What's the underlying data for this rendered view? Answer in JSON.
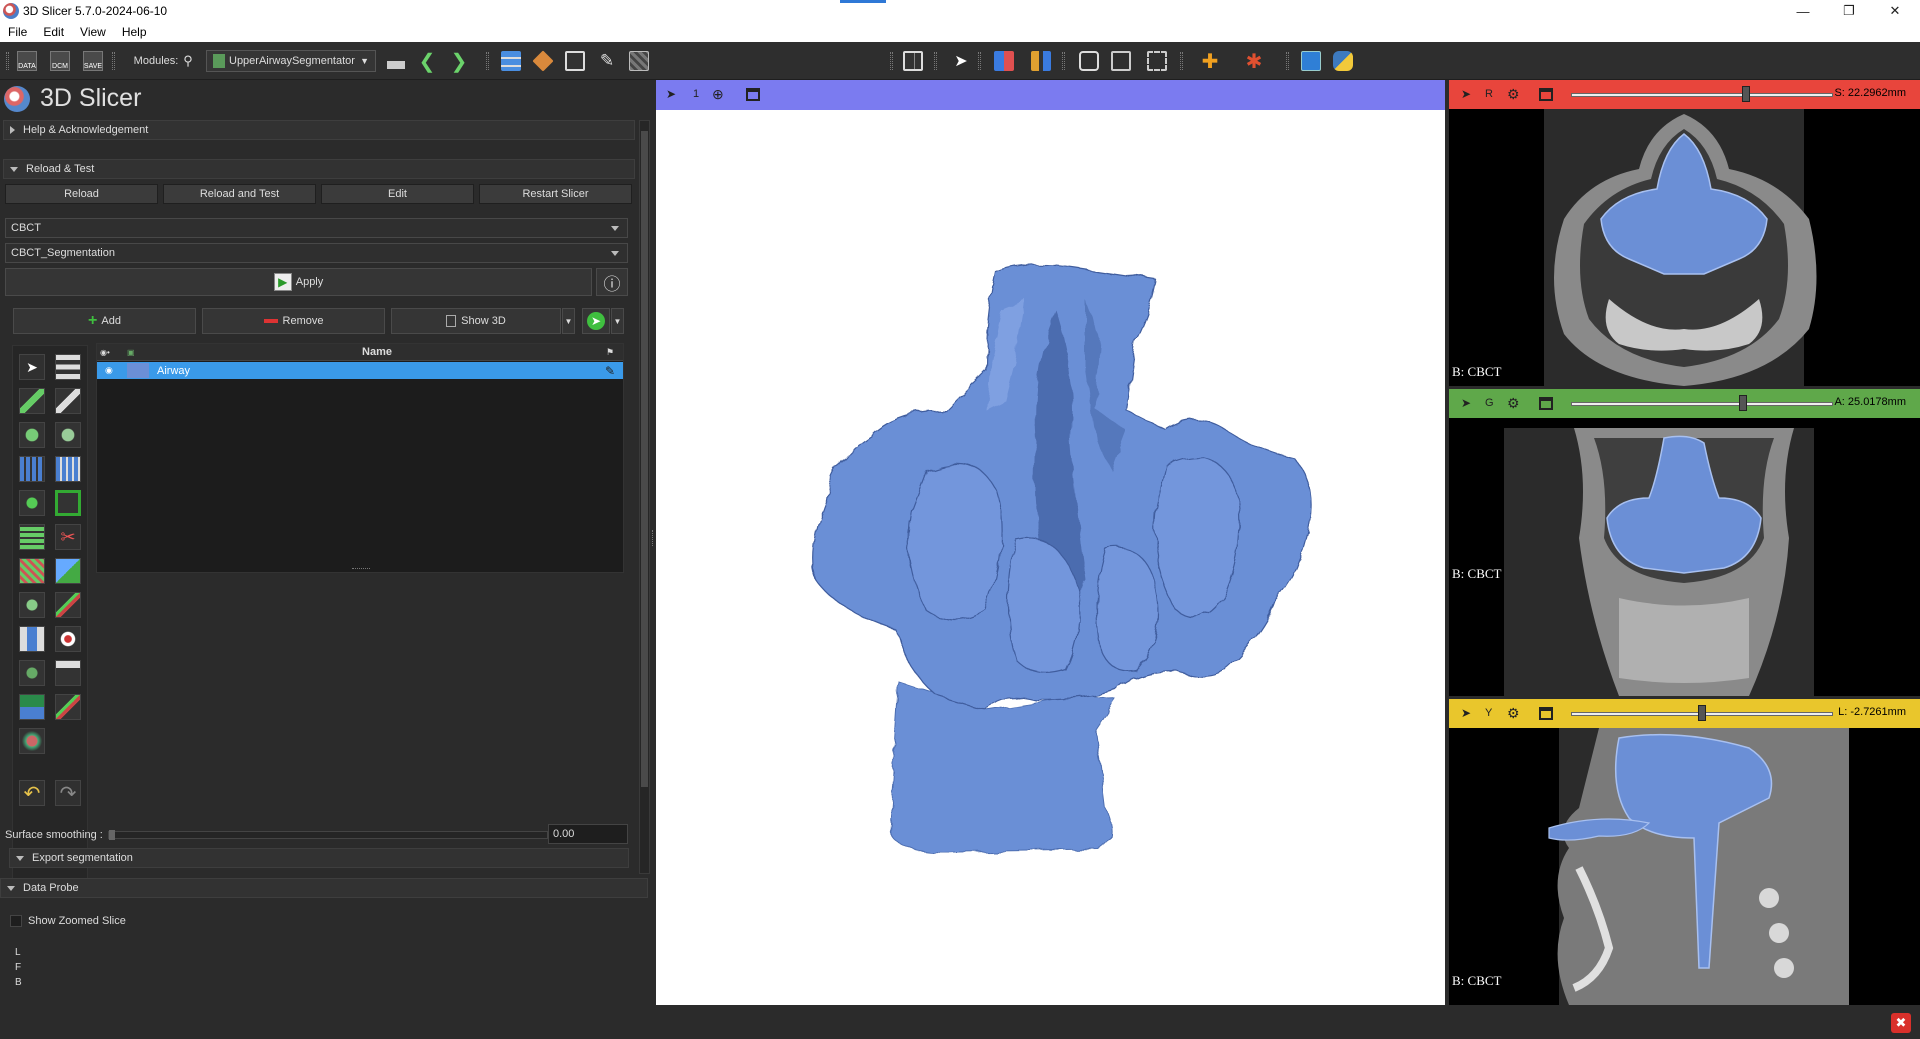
{
  "window": {
    "title": "3D Slicer 5.7.0-2024-06-10",
    "minimize": "—",
    "restore": "❐",
    "close": "✕"
  },
  "menu": [
    "File",
    "Edit",
    "View",
    "Help"
  ],
  "toolbar": {
    "data_label": "DATA",
    "dcm_label": "DCM",
    "save_label": "SAVE",
    "modules_label": "Modules:",
    "module_selected": "UpperAirwaySegmentator"
  },
  "app": {
    "name": "3D Slicer"
  },
  "sections": {
    "help": "Help & Acknowledgement",
    "reload": "Reload & Test",
    "export": "Export segmentation",
    "data_probe": "Data Probe"
  },
  "reload_buttons": {
    "reload": "Reload",
    "reload_and_test": "Reload and Test",
    "edit": "Edit",
    "restart": "Restart Slicer"
  },
  "inputs": {
    "volume": "CBCT",
    "segmentation": "CBCT_Segmentation",
    "apply": "Apply"
  },
  "segment_actions": {
    "add": "Add",
    "remove": "Remove",
    "show3d": "Show 3D"
  },
  "segments_table": {
    "name_header": "Name",
    "rows": [
      {
        "name": "Airway",
        "color": "#6b8fd6"
      }
    ]
  },
  "surface_smoothing": {
    "label": "Surface smoothing :",
    "value": "0.00"
  },
  "data_probe": {
    "show_zoomed": "Show Zoomed Slice",
    "lines": [
      "L",
      "F",
      "B"
    ]
  },
  "viewer3d": {
    "label": "1",
    "background": "#ffffff",
    "model_color": "#6b8fd6"
  },
  "slices": [
    {
      "name": "R",
      "color": "#e8453c",
      "offset": "S: 22.2962mm",
      "bg": "B: CBCT",
      "level": 0.66
    },
    {
      "name": "G",
      "color": "#5fa84a",
      "offset": "A: 25.0178mm",
      "bg": "B: CBCT",
      "level": 0.65
    },
    {
      "name": "Y",
      "color": "#e9c62c",
      "offset": "L: -2.7261mm",
      "bg": "B: CBCT",
      "level": 0.49
    }
  ]
}
